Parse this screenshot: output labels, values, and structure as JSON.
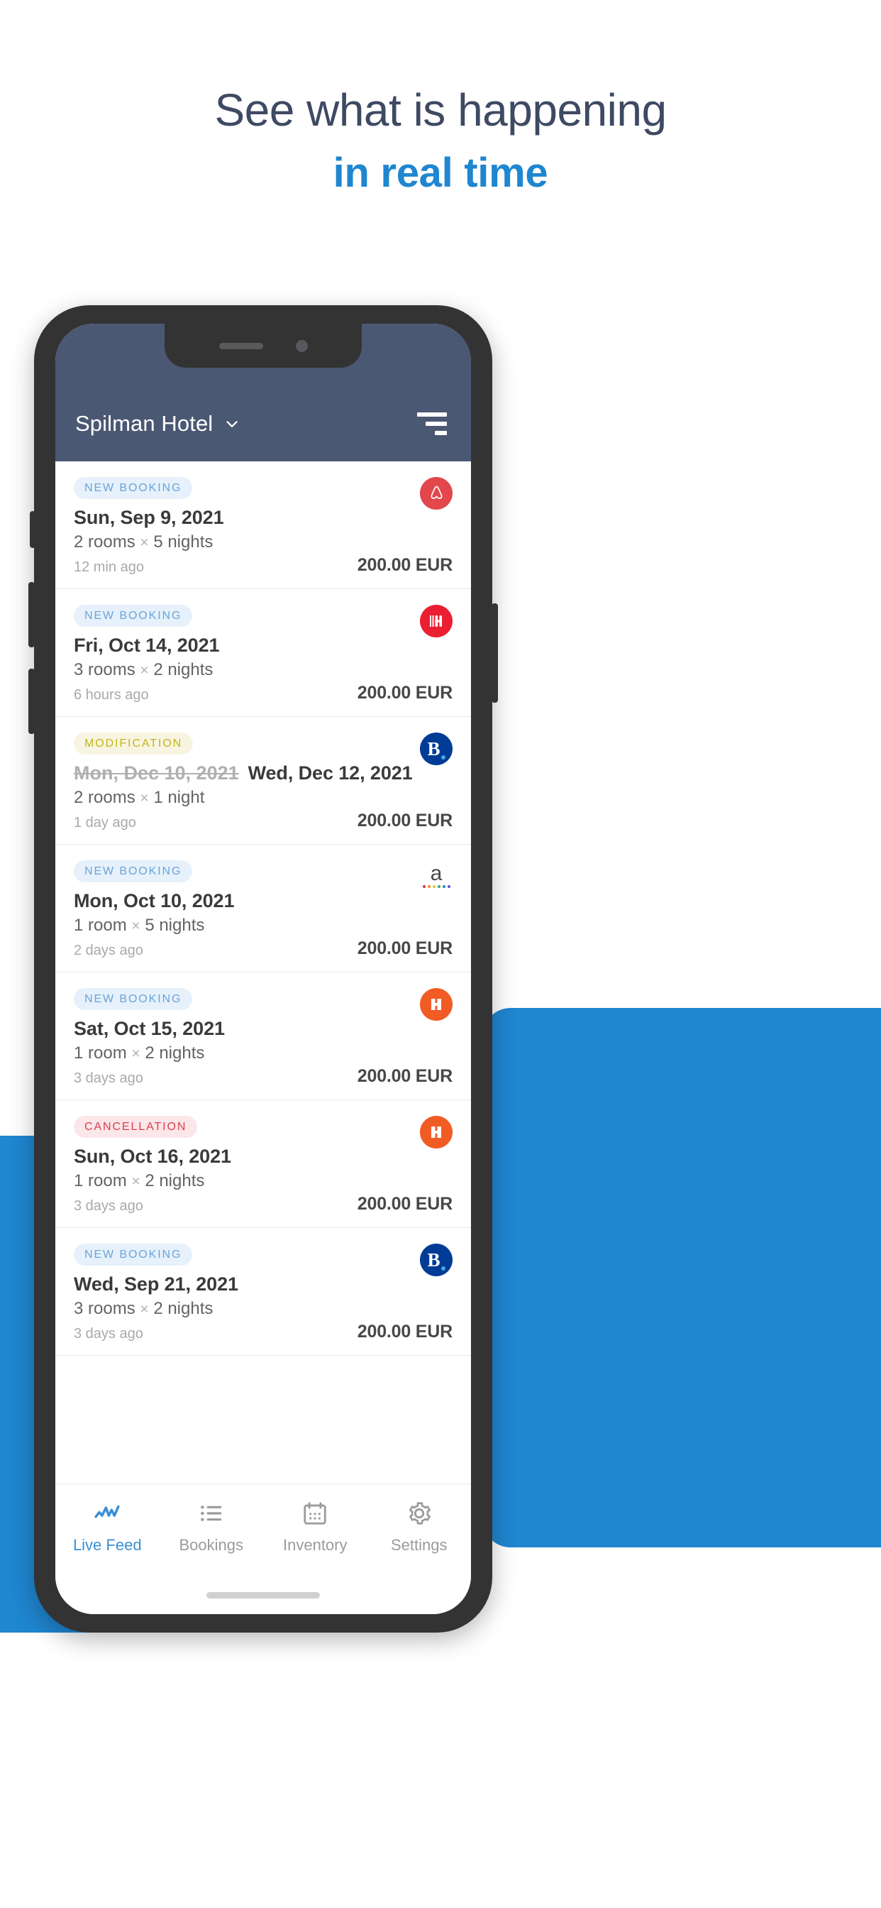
{
  "promo": {
    "line1": "See what is happening",
    "line2": "in real time",
    "accent_color": "#1f86d0",
    "headline_color": "#3e4a63",
    "green_color": "#13b23c"
  },
  "phone": {
    "appbar": {
      "hotel_name": "Spilman Hotel",
      "chevron_icon": "chevron-down-icon",
      "filter_icon": "filter-icon",
      "background_color": "#4b5873"
    },
    "feed": [
      {
        "badge": "NEW BOOKING",
        "badge_type": "new",
        "date": "Sun, Sep 9, 2021",
        "old_date": "",
        "rooms": "2 rooms",
        "times": "×",
        "nights": "5 nights",
        "ago": "12 min ago",
        "price": "200.00 EUR",
        "channel": "airbnb",
        "channel_label": "Airbnb"
      },
      {
        "badge": "NEW BOOKING",
        "badge_type": "new",
        "date": "Fri, Oct 14, 2021",
        "old_date": "",
        "rooms": "3 rooms",
        "times": "×",
        "nights": "2 nights",
        "ago": "6 hours ago",
        "price": "200.00 EUR",
        "channel": "hotels",
        "channel_label": "Hotels.com"
      },
      {
        "badge": "MODIFICATION",
        "badge_type": "mod",
        "date": "Wed, Dec 12, 2021",
        "old_date": "Mon, Dec 10, 2021",
        "rooms": "2 rooms",
        "times": "×",
        "nights": "1 night",
        "ago": "1 day ago",
        "price": "200.00 EUR",
        "channel": "booking",
        "channel_label": "Booking.com"
      },
      {
        "badge": "NEW BOOKING",
        "badge_type": "new",
        "date": "Mon, Oct 10, 2021",
        "old_date": "",
        "rooms": "1 room",
        "times": "×",
        "nights": "5 nights",
        "ago": "2 days ago",
        "price": "200.00 EUR",
        "channel": "agoda",
        "channel_label": "Agoda"
      },
      {
        "badge": "NEW BOOKING",
        "badge_type": "new",
        "date": "Sat, Oct 15, 2021",
        "old_date": "",
        "rooms": "1 room",
        "times": "×",
        "nights": "2 nights",
        "ago": "3 days ago",
        "price": "200.00 EUR",
        "channel": "hrs",
        "channel_label": "HRS"
      },
      {
        "badge": "CANCELLATION",
        "badge_type": "cancel",
        "date": "Sun, Oct 16, 2021",
        "old_date": "",
        "rooms": "1 room",
        "times": "×",
        "nights": "2 nights",
        "ago": "3 days ago",
        "price": "200.00 EUR",
        "channel": "hrs",
        "channel_label": "HRS"
      },
      {
        "badge": "NEW BOOKING",
        "badge_type": "new",
        "date": "Wed, Sep 21, 2021",
        "old_date": "",
        "rooms": "3 rooms",
        "times": "×",
        "nights": "2 nights",
        "ago": "3 days ago",
        "price": "200.00 EUR",
        "channel": "booking",
        "channel_label": "Booking.com"
      }
    ],
    "bottom_nav": [
      {
        "label": "Live Feed",
        "icon": "live-feed-icon",
        "active": true
      },
      {
        "label": "Bookings",
        "icon": "list-icon",
        "active": false
      },
      {
        "label": "Inventory",
        "icon": "calendar-icon",
        "active": false
      },
      {
        "label": "Settings",
        "icon": "gear-icon",
        "active": false
      }
    ],
    "badge_colors": {
      "new_bg": "#e6f1fb",
      "new_fg": "#6ba4d8",
      "mod_bg": "#f7f5e2",
      "mod_fg": "#c5b418",
      "cancel_bg": "#fbe6e9",
      "cancel_fg": "#d9404f"
    },
    "channel_colors": {
      "airbnb": "#e1474b",
      "hotels": "#ea1f32",
      "booking": "#003b95",
      "hrs": "#f15b24",
      "agoda": "#4a4a4a"
    }
  }
}
